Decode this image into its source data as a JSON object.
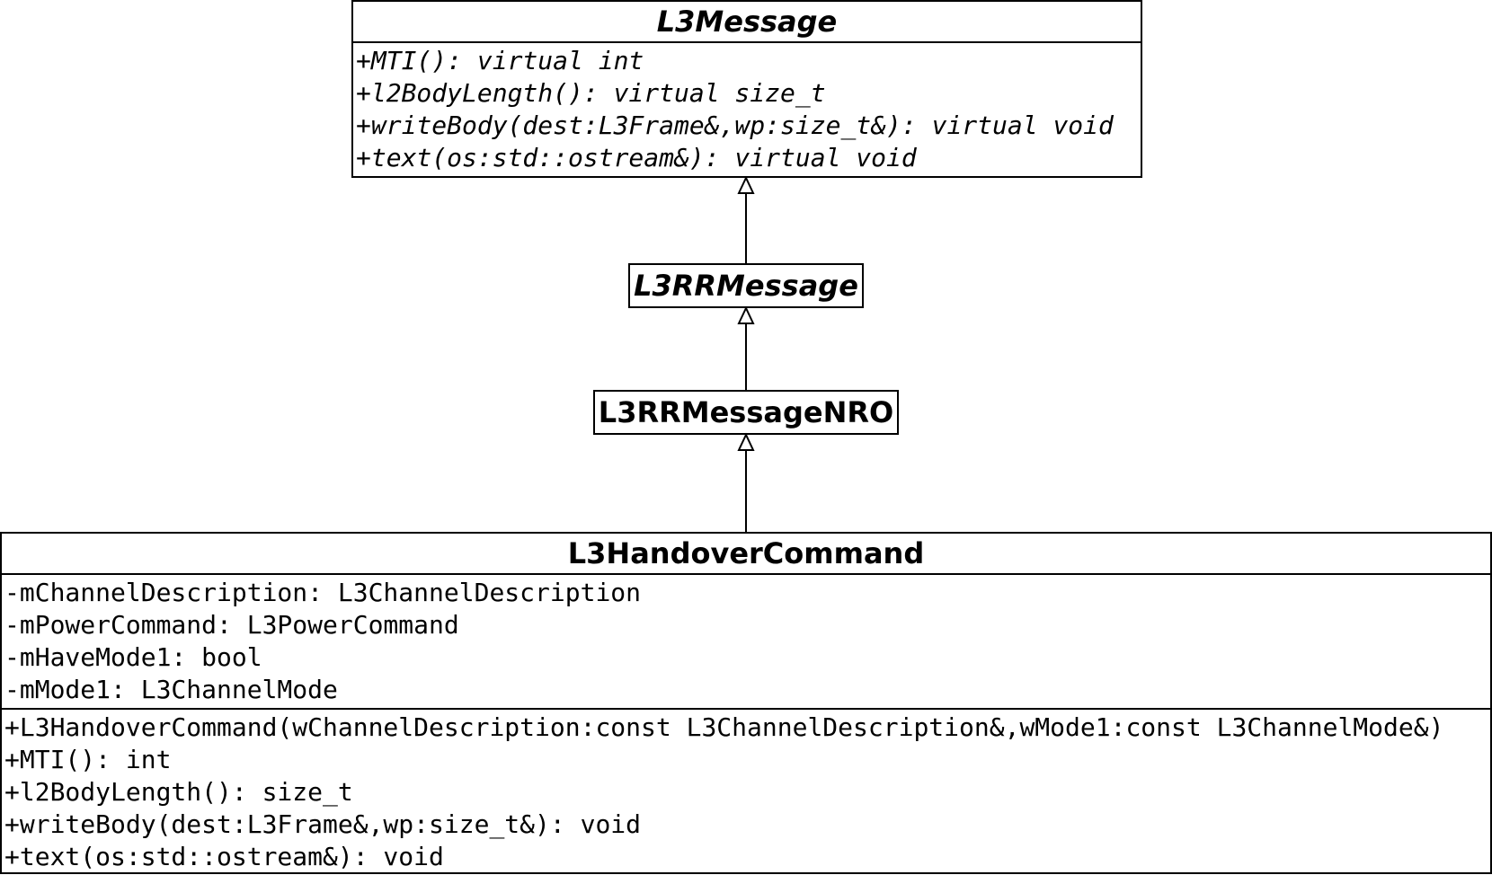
{
  "classes": {
    "l3message": {
      "name": "L3Message",
      "abstract": true,
      "operations": [
        "+MTI(): virtual int",
        "+l2BodyLength(): virtual size_t",
        "+writeBody(dest:L3Frame&,wp:size_t&): virtual void",
        "+text(os:std::ostream&): virtual void"
      ]
    },
    "l3rrmessage": {
      "name": "L3RRMessage",
      "abstract": true
    },
    "l3rrmessagenro": {
      "name": "L3RRMessageNRO",
      "abstract": false
    },
    "l3handovercommand": {
      "name": "L3HandoverCommand",
      "abstract": false,
      "attributes": [
        "-mChannelDescription: L3ChannelDescription",
        "-mPowerCommand: L3PowerCommand",
        "-mHaveMode1: bool",
        "-mMode1: L3ChannelMode"
      ],
      "operations": [
        "+L3HandoverCommand(wChannelDescription:const L3ChannelDescription&,wMode1:const L3ChannelMode&)",
        "+MTI(): int",
        "+l2BodyLength(): size_t",
        "+writeBody(dest:L3Frame&,wp:size_t&): void",
        "+text(os:std::ostream&): void"
      ]
    }
  },
  "relations": [
    {
      "type": "generalization",
      "from": "L3RRMessage",
      "to": "L3Message"
    },
    {
      "type": "generalization",
      "from": "L3RRMessageNRO",
      "to": "L3RRMessage"
    },
    {
      "type": "generalization",
      "from": "L3HandoverCommand",
      "to": "L3RRMessageNRO"
    }
  ]
}
